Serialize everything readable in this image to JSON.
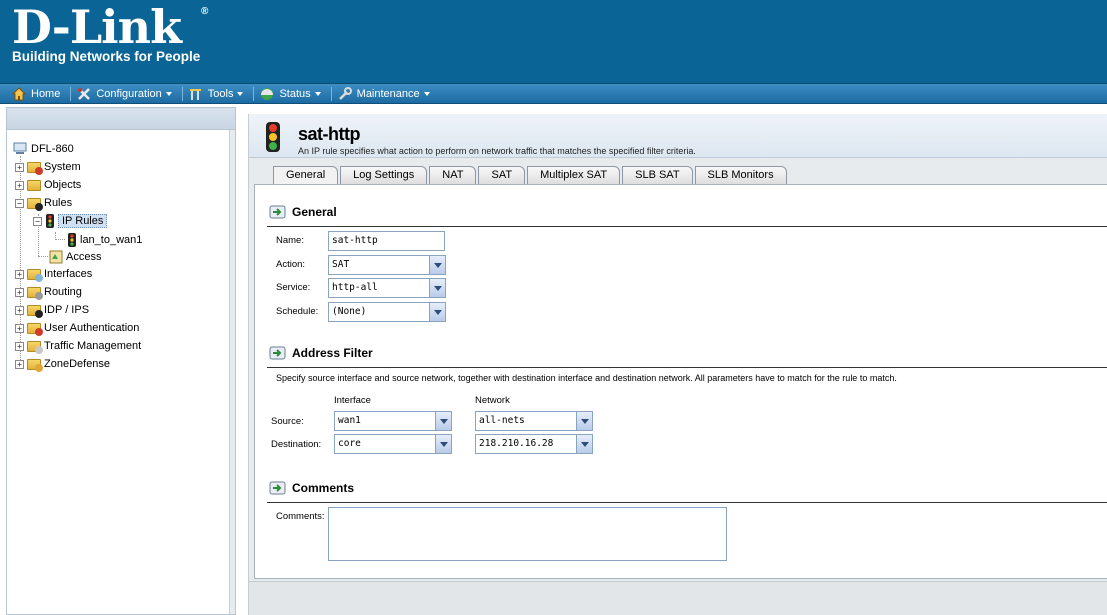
{
  "brand": {
    "name": "D-Link",
    "reg": "®",
    "tagline": "Building Networks for People"
  },
  "nav": {
    "items": [
      {
        "label": "Home",
        "icon": "home-icon",
        "dropdown": false
      },
      {
        "label": "Configuration",
        "icon": "configuration-icon",
        "dropdown": true
      },
      {
        "label": "Tools",
        "icon": "tools-icon",
        "dropdown": true
      },
      {
        "label": "Status",
        "icon": "status-icon",
        "dropdown": true
      },
      {
        "label": "Maintenance",
        "icon": "maintenance-icon",
        "dropdown": true
      }
    ]
  },
  "tree": {
    "root": "DFL-860",
    "items": [
      {
        "label": "System",
        "expander": "+"
      },
      {
        "label": "Objects",
        "expander": "+"
      },
      {
        "label": "Rules",
        "expander": "−"
      },
      {
        "label": "IP Rules",
        "expander": "−"
      },
      {
        "label": "lan_to_wan1"
      },
      {
        "label": "Access"
      },
      {
        "label": "Interfaces",
        "expander": "+"
      },
      {
        "label": "Routing",
        "expander": "+"
      },
      {
        "label": "IDP / IPS",
        "expander": "+"
      },
      {
        "label": "User Authentication",
        "expander": "+"
      },
      {
        "label": "Traffic Management",
        "expander": "+"
      },
      {
        "label": "ZoneDefense",
        "expander": "+"
      }
    ]
  },
  "page": {
    "title": "sat-http",
    "subtitle": "An IP rule specifies what action to perform on network traffic that matches the specified filter criteria."
  },
  "tabs": [
    "General",
    "Log Settings",
    "NAT",
    "SAT",
    "Multiplex SAT",
    "SLB SAT",
    "SLB Monitors"
  ],
  "general": {
    "title": "General",
    "name_label": "Name:",
    "name_value": "sat-http",
    "action_label": "Action:",
    "action_value": "SAT",
    "service_label": "Service:",
    "service_value": "http-all",
    "schedule_label": "Schedule:",
    "schedule_value": "(None)"
  },
  "address_filter": {
    "title": "Address Filter",
    "description": "Specify source interface and source network, together with destination interface and destination network. All parameters have to match for the rule to match.",
    "col_interface": "Interface",
    "col_network": "Network",
    "source_label": "Source:",
    "source_interface": "wan1",
    "source_network": "all-nets",
    "destination_label": "Destination:",
    "destination_interface": "core",
    "destination_network": "218.210.16.28"
  },
  "comments": {
    "title": "Comments",
    "label": "Comments:"
  }
}
